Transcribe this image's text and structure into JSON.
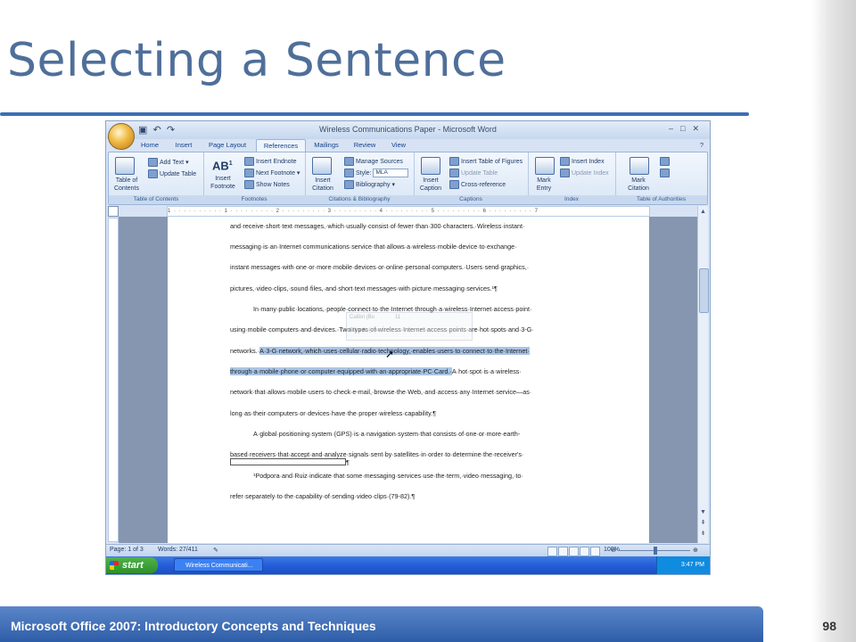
{
  "slide": {
    "title": "Selecting a Sentence",
    "footer": "Microsoft Office 2007: Introductory Concepts and Techniques",
    "page_number": "98"
  },
  "word": {
    "window_title": "Wireless Communications Paper - Microsoft Word",
    "tabs": [
      "Home",
      "Insert",
      "Page Layout",
      "References",
      "Mailings",
      "Review",
      "View"
    ],
    "active_tab": "References",
    "ribbon": {
      "toc": {
        "label": "Table of Contents",
        "big": "Table of Contents",
        "add_text": "Add Text",
        "update_table": "Update Table"
      },
      "footnotes": {
        "label": "Footnotes",
        "big": "Insert Footnote",
        "insert_endnote": "Insert Endnote",
        "next_footnote": "Next Footnote",
        "show_notes": "Show Notes"
      },
      "citations": {
        "label": "Citations & Bibliography",
        "big": "Insert Citation",
        "manage_sources": "Manage Sources",
        "style_label": "Style:",
        "style_value": "MLA",
        "bibliography": "Bibliography"
      },
      "captions": {
        "label": "Captions",
        "big": "Insert Caption",
        "insert_tof": "Insert Table of Figures",
        "update_table": "Update Table",
        "cross_reference": "Cross-reference"
      },
      "index": {
        "label": "Index",
        "big": "Mark Entry",
        "insert_index": "Insert Index",
        "update_index": "Update Index"
      },
      "toa": {
        "label": "Table of Authorities",
        "big": "Mark Citation"
      }
    },
    "ruler_marks": "1 · · · · · · · · · · 1 · · · · · · · · · 2 · · · · · · · · · 3 · · · · · · · · · 4 · · · · · · · · · 5 · · · · · · · · · 6 · · · · · · · · · 7",
    "document_lines": [
      "and·receive·short·text·messages,·which·usually·consist·of·fewer·than·300·characters.·Wireless·instant·",
      "messaging·is·an·Internet·communications·service·that·allows·a·wireless·mobile·device·to·exchange·",
      "instant·messages·with·one·or·more·mobile·devices·or·online·personal·computers.·Users·send·graphics,·",
      "pictures,·video·clips,·sound·files,·and·short·text·messages·with·picture·messaging·services.¹¶",
      "In·many·public·locations,·people·connect·to·the·Internet·through·a·wireless·Internet·access·point·",
      "using·mobile·computers·and·devices.·Two·types·of·wireless·Internet·access·points·are·hot·spots·and·3-G·"
    ],
    "sel_line1": {
      "before": "networks.·",
      "selected": "A·3-G·network,·which·uses·cellular·radio·technology,·enables·users·to·connect·to·the·Internet·"
    },
    "sel_line2": {
      "selected": "through·a·mobile·phone·or·computer·equipped·with·an·appropriate·PC·Card.·",
      "after": "A·hot·spot·is·a·wireless·"
    },
    "document_lines_after": [
      "network·that·allows·mobile·users·to·check·e-mail,·browse·the·Web,·and·access·any·Internet·service—as·",
      "long·as·their·computers·or·devices·have·the·proper·wireless·capability.¶",
      "A·global·positioning·system·(GPS)·is·a·navigation·system·that·consists·of·one·or·more·earth-",
      "based·receivers·that·accept·and·analyze·signals·sent·by·satellites·in·order·to·determine·the·receiver's·"
    ],
    "footnote_mark": "¶",
    "footnote_lines": [
      "¹Podpora·and·Ruiz·indicate·that·some·messaging·services·use·the·term,·video·messaging,·to·",
      "refer·separately·to·the·capability·of·sending·video·clips·(79-82).¶"
    ],
    "mini_toolbar": {
      "font": "Calibri (Bo",
      "size": "11"
    },
    "status": {
      "page": "Page: 1 of 3",
      "words": "Words: 27/411",
      "zoom": "100%"
    },
    "taskbar": {
      "start": "start",
      "task": "Wireless Communicati...",
      "clock": "3:47 PM"
    }
  }
}
